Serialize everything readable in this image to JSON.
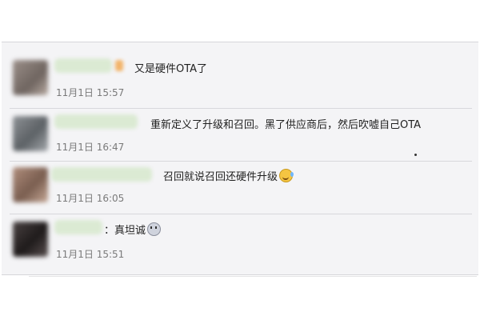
{
  "comments": [
    {
      "message": "又是硬件OTA了",
      "time": "11月1日 15:57",
      "avatar_color": "#8a7d78",
      "has_tag": true
    },
    {
      "message": "重新定义了升级和召回。黑了供应商后，然后吹嘘自己OTA",
      "time": "11月1日 16:47",
      "avatar_color": "#7b7f83",
      "has_tag": false
    },
    {
      "message": "召回就说召回还硬件升级",
      "time": "11月1日 16:05",
      "avatar_color": "#9a7a6a",
      "emoji": "laughing-tears-emoji"
    },
    {
      "message": "：真坦诚",
      "time": "11月1日 15:51",
      "avatar_color": "#3a3434",
      "emoji": "speechless-face-emoji"
    }
  ]
}
